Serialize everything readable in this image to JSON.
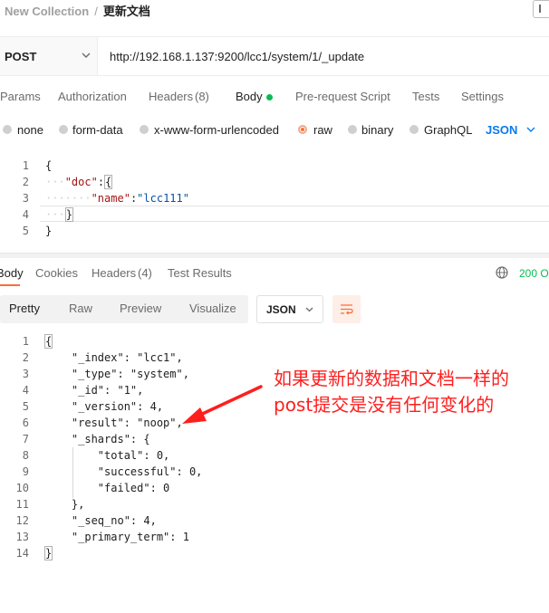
{
  "breadcrumb": {
    "collection": "New Collection",
    "separator": "/",
    "document": "更新文档"
  },
  "request": {
    "method": "POST",
    "url": "http://192.168.1.137:9200/lcc1/system/1/_update"
  },
  "request_tabs": [
    "Params",
    "Authorization",
    "Headers",
    "(8)",
    "Body",
    "Pre-request Script",
    "Tests",
    "Settings"
  ],
  "body_types": [
    "none",
    "form-data",
    "x-www-form-urlencoded",
    "raw",
    "binary",
    "GraphQL"
  ],
  "body_format": "JSON",
  "request_body": {
    "line_numbers": [
      "1",
      "2",
      "3",
      "4",
      "5"
    ],
    "open_brace": "{",
    "doc_key": "\"doc\"",
    "colon": ":",
    "doc_open": "{",
    "name_key": "\"name\"",
    "name_value": "\"lcc111\"",
    "doc_close": "}",
    "close_brace": "}"
  },
  "response_tabs": [
    "Body",
    "Cookies",
    "Headers",
    "(4)",
    "Test Results"
  ],
  "status_text": "200 O",
  "view_modes": [
    "Pretty",
    "Raw",
    "Preview",
    "Visualize"
  ],
  "response_format": "JSON",
  "response_body": {
    "line_numbers": [
      "1",
      "2",
      "3",
      "4",
      "5",
      "6",
      "7",
      "8",
      "9",
      "10",
      "11",
      "12",
      "13",
      "14"
    ],
    "lines": [
      "{",
      "    \"_index\": \"lcc1\",",
      "    \"_type\": \"system\",",
      "    \"_id\": \"1\",",
      "    \"_version\": 4,",
      "    \"result\": \"noop\",",
      "    \"_shards\": {",
      "        \"total\": 0,",
      "        \"successful\": 0,",
      "        \"failed\": 0",
      "    },",
      "    \"_seq_no\": 4,",
      "    \"_primary_term\": 1",
      "}"
    ]
  },
  "annotation": {
    "line1": "如果更新的数据和文档一样的",
    "line2": "post提交是没有任何变化的"
  },
  "colors": {
    "accent": "#ff6c37",
    "link": "#097bed",
    "success": "#0cbb52",
    "annotation": "#ff1e1e"
  }
}
